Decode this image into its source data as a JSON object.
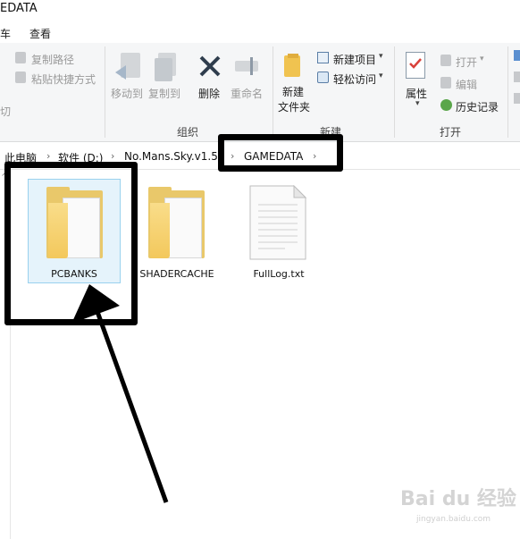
{
  "window": {
    "title": "EDATA"
  },
  "tabs": {
    "left_fragment": "车",
    "view": "查看"
  },
  "ribbon": {
    "clipboard": {
      "copy_path": "复制路径",
      "paste_shortcut": "粘贴快捷方式",
      "cut_fragment": "切"
    },
    "organize": {
      "move_to": "移动到",
      "copy_to": "复制到",
      "delete": "删除",
      "rename": "重命名",
      "label": "组织"
    },
    "new": {
      "new_folder_line1": "新建",
      "new_folder_line2": "文件夹",
      "new_item": "新建项目",
      "easy_access": "轻松访问",
      "label": "新建"
    },
    "open": {
      "properties": "属性",
      "open": "打开",
      "edit": "编辑",
      "history": "历史记录",
      "label": "打开"
    }
  },
  "address": {
    "crumbs": [
      "此电脑",
      "软件 (D:)",
      "No.Mans.Sky.v1.5",
      "GAMEDATA"
    ]
  },
  "files": [
    {
      "name": "PCBANKS",
      "type": "folder"
    },
    {
      "name": "SHADERCACHE",
      "type": "folder"
    },
    {
      "name": "FullLog.txt",
      "type": "text-file"
    }
  ],
  "watermark": {
    "brand": "Bai du 经验",
    "url": "jingyan.baidu.com"
  },
  "colors": {
    "folder": "#f3c85c",
    "annotation": "#000000",
    "selection": "#cce8ff"
  }
}
